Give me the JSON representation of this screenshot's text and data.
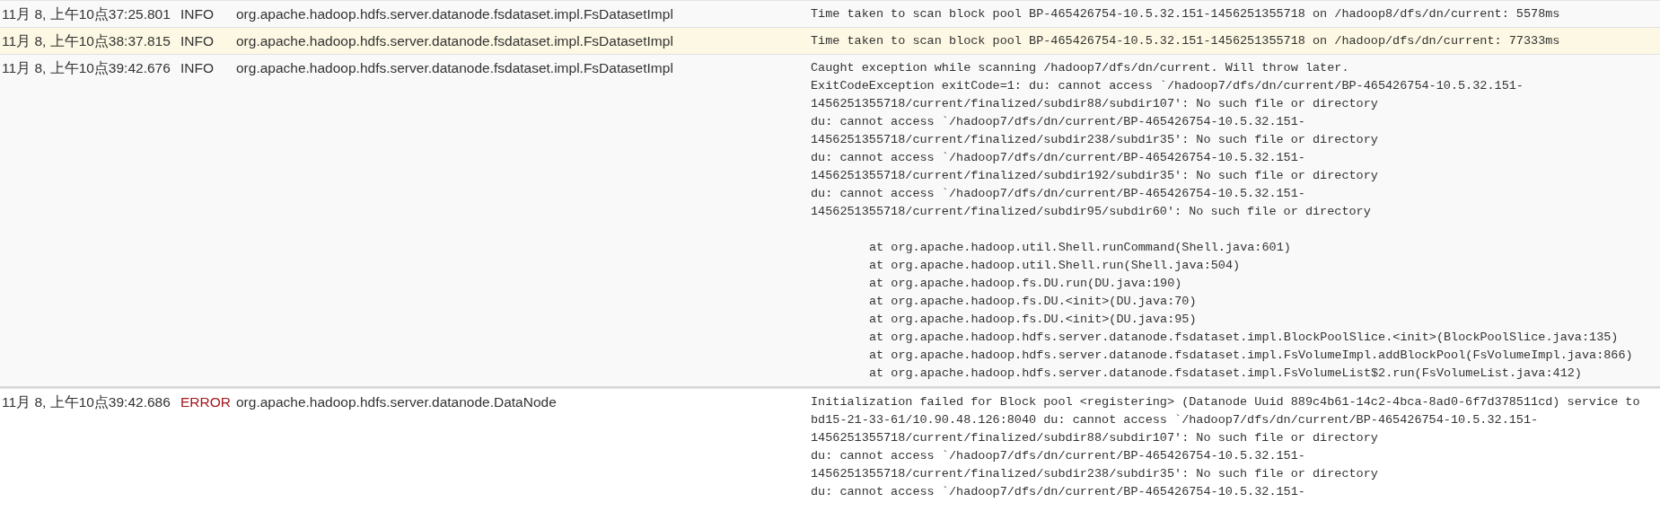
{
  "log_entries": [
    {
      "time": "11月 8, 上午10点37:25.801",
      "level": "INFO",
      "source": "org.apache.hadoop.hdfs.server.datanode.fsdataset.impl.FsDatasetImpl",
      "selected": false,
      "message": [
        {
          "kind": "text",
          "lines": [
            "Time taken to scan block pool BP-465426754-10.5.32.151-1456251355718 on /hadoop8/dfs/dn/current: 5578ms"
          ]
        }
      ]
    },
    {
      "time": "11月 8, 上午10点38:37.815",
      "level": "INFO",
      "source": "org.apache.hadoop.hdfs.server.datanode.fsdataset.impl.FsDatasetImpl",
      "selected": true,
      "message": [
        {
          "kind": "text",
          "lines": [
            "Time taken to scan block pool BP-465426754-10.5.32.151-1456251355718 on /hadoop/dfs/dn/current: 77333ms"
          ]
        }
      ]
    },
    {
      "time": "11月 8, 上午10点39:42.676",
      "level": "INFO",
      "source": "org.apache.hadoop.hdfs.server.datanode.fsdataset.impl.FsDatasetImpl",
      "selected": false,
      "message": [
        {
          "kind": "text",
          "lines": [
            "Caught exception while scanning /hadoop7/dfs/dn/current. Will throw later.",
            "ExitCodeException exitCode=1: du: cannot access `/hadoop7/dfs/dn/current/BP-465426754-10.5.32.151-",
            "1456251355718/current/finalized/subdir88/subdir107': No such file or directory",
            "du: cannot access `/hadoop7/dfs/dn/current/BP-465426754-10.5.32.151-",
            "1456251355718/current/finalized/subdir238/subdir35': No such file or directory",
            "du: cannot access `/hadoop7/dfs/dn/current/BP-465426754-10.5.32.151-",
            "1456251355718/current/finalized/subdir192/subdir35': No such file or directory",
            "du: cannot access `/hadoop7/dfs/dn/current/BP-465426754-10.5.32.151-",
            "1456251355718/current/finalized/subdir95/subdir60': No such file or directory"
          ]
        },
        {
          "kind": "trace",
          "lines": [
            "at org.apache.hadoop.util.Shell.runCommand(Shell.java:601)",
            "at org.apache.hadoop.util.Shell.run(Shell.java:504)",
            "at org.apache.hadoop.fs.DU.run(DU.java:190)",
            "at org.apache.hadoop.fs.DU.<init>(DU.java:70)",
            "at org.apache.hadoop.fs.DU.<init>(DU.java:95)",
            "at org.apache.hadoop.hdfs.server.datanode.fsdataset.impl.BlockPoolSlice.<init>(BlockPoolSlice.java:135)",
            "at org.apache.hadoop.hdfs.server.datanode.fsdataset.impl.FsVolumeImpl.addBlockPool(FsVolumeImpl.java:866)",
            "at org.apache.hadoop.hdfs.server.datanode.fsdataset.impl.FsVolumeList$2.run(FsVolumeList.java:412)"
          ]
        }
      ]
    },
    {
      "time": "11月 8, 上午10点39:42.686",
      "level": "ERROR",
      "source": "org.apache.hadoop.hdfs.server.datanode.DataNode",
      "selected": false,
      "message": [
        {
          "kind": "text",
          "lines": [
            "Initialization failed for Block pool <registering> (Datanode Uuid 889c4b61-14c2-4bca-8ad0-6f7d378511cd) service to",
            "bd15-21-33-61/10.90.48.126:8040 du: cannot access `/hadoop7/dfs/dn/current/BP-465426754-10.5.32.151-",
            "1456251355718/current/finalized/subdir88/subdir107': No such file or directory",
            "du: cannot access `/hadoop7/dfs/dn/current/BP-465426754-10.5.32.151-",
            "1456251355718/current/finalized/subdir238/subdir35': No such file or directory",
            "du: cannot access `/hadoop7/dfs/dn/current/BP-465426754-10.5.32.151-"
          ]
        }
      ]
    }
  ]
}
